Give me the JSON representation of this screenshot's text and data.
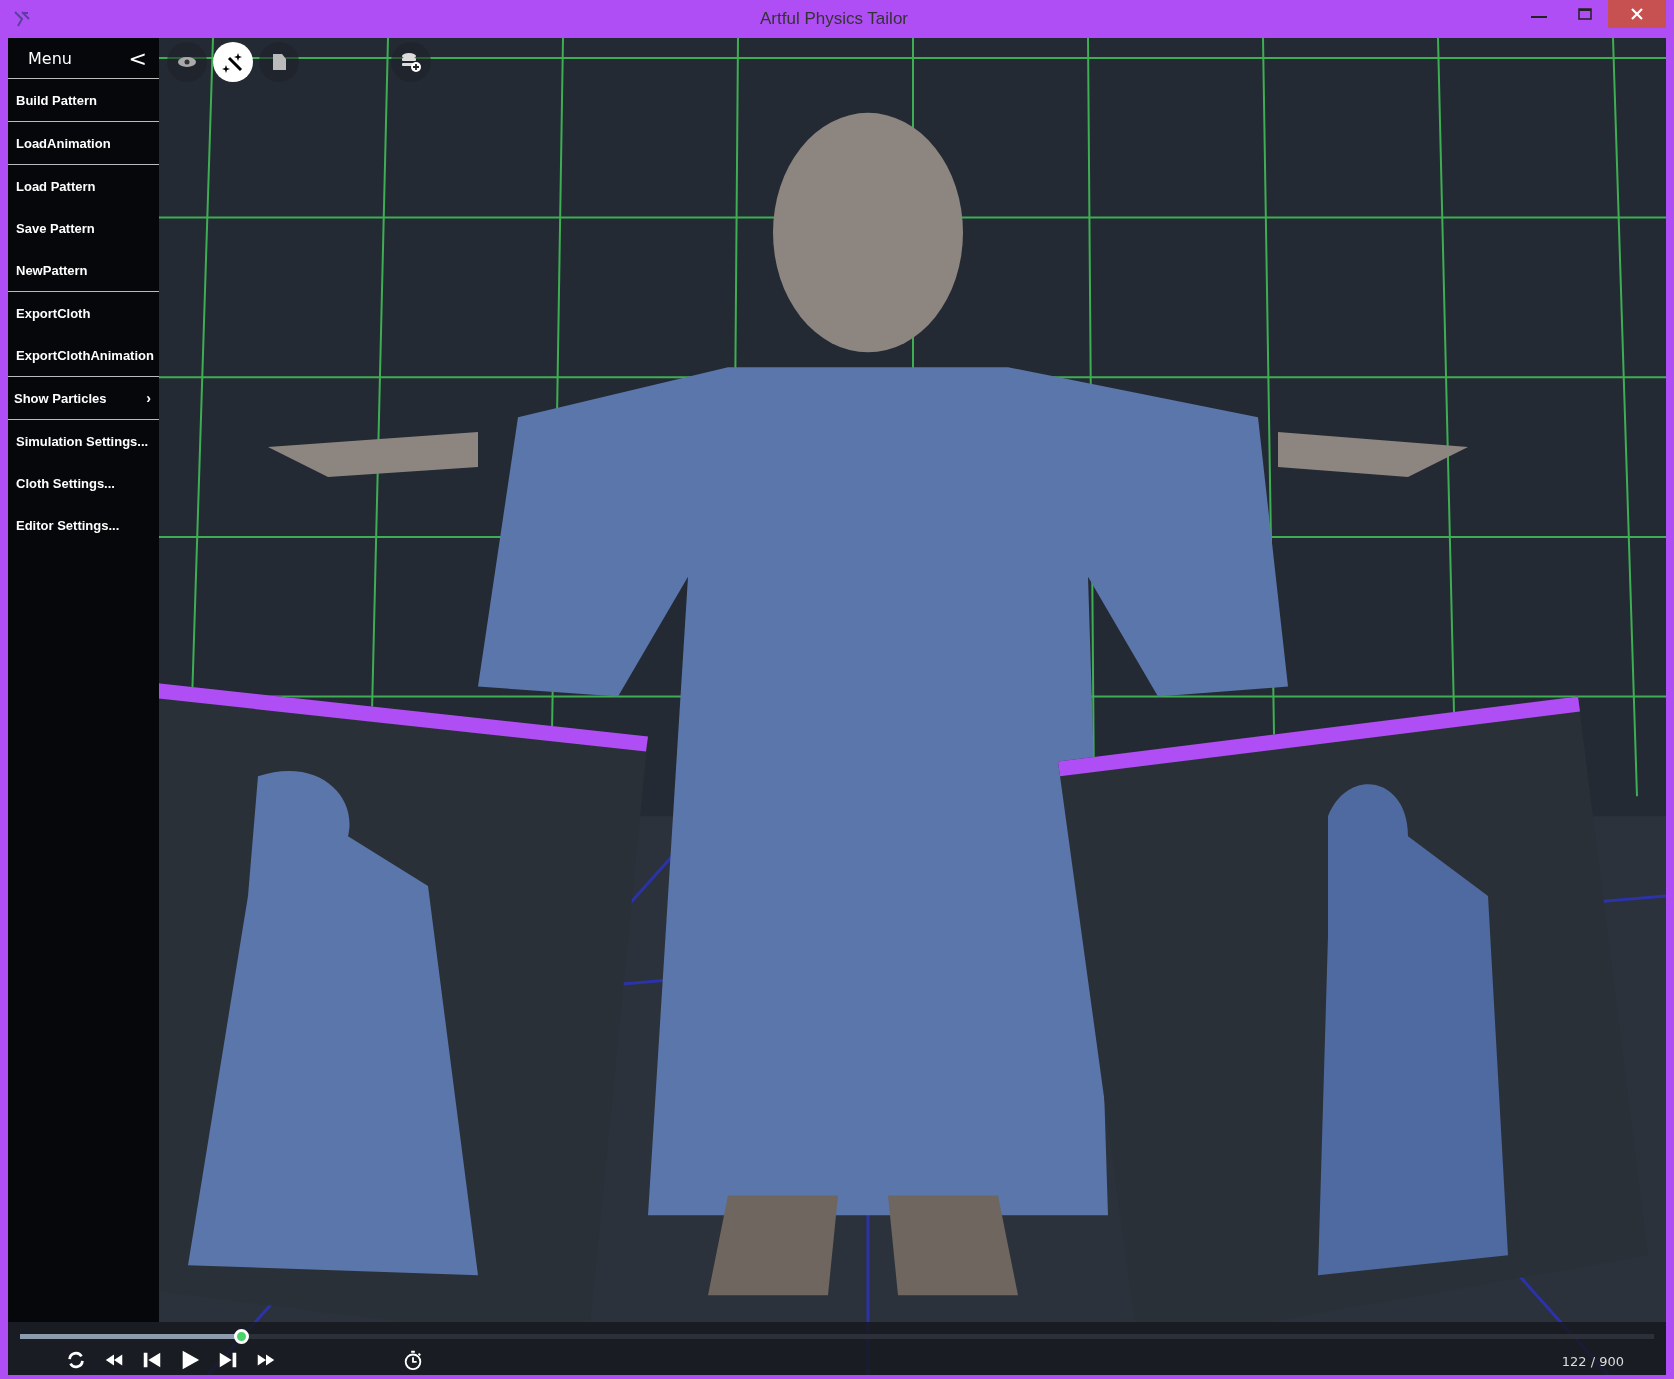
{
  "window": {
    "title": "Artful Physics Tailor"
  },
  "menu": {
    "title": "Menu",
    "collapse": "<",
    "groups": [
      [
        {
          "label": "Build Pattern",
          "kind": "action"
        }
      ],
      [
        {
          "label": "LoadAnimation",
          "kind": "action"
        }
      ],
      [
        {
          "label": "Load Pattern",
          "kind": "action"
        },
        {
          "label": "Save Pattern",
          "kind": "action"
        },
        {
          "label": "NewPattern",
          "kind": "action"
        }
      ],
      [
        {
          "label": "ExportCloth",
          "kind": "action"
        },
        {
          "label": "ExportClothAnimation",
          "kind": "action"
        }
      ],
      [
        {
          "label": "Show Particles",
          "kind": "submenu",
          "arrow": "›"
        }
      ],
      [
        {
          "label": "Simulation Settings...",
          "kind": "action"
        },
        {
          "label": "Cloth Settings...",
          "kind": "action"
        },
        {
          "label": "Editor Settings...",
          "kind": "action"
        }
      ]
    ]
  },
  "toolbar": [
    {
      "kind": "eye",
      "selected": false
    },
    {
      "kind": "wand",
      "selected": true
    },
    {
      "kind": "document",
      "selected": false
    },
    {
      "kind": "spacer"
    },
    {
      "kind": "database-add",
      "selected": false
    }
  ],
  "timeline": {
    "level": 0.135,
    "frame": "122 / 900"
  },
  "playback": [
    {
      "kind": "loop"
    },
    {
      "kind": "rewind"
    },
    {
      "kind": "step-back"
    },
    {
      "kind": "play"
    },
    {
      "kind": "step-forward"
    },
    {
      "kind": "fast-forward"
    },
    {
      "kind": "spacer"
    },
    {
      "kind": "timer"
    }
  ]
}
